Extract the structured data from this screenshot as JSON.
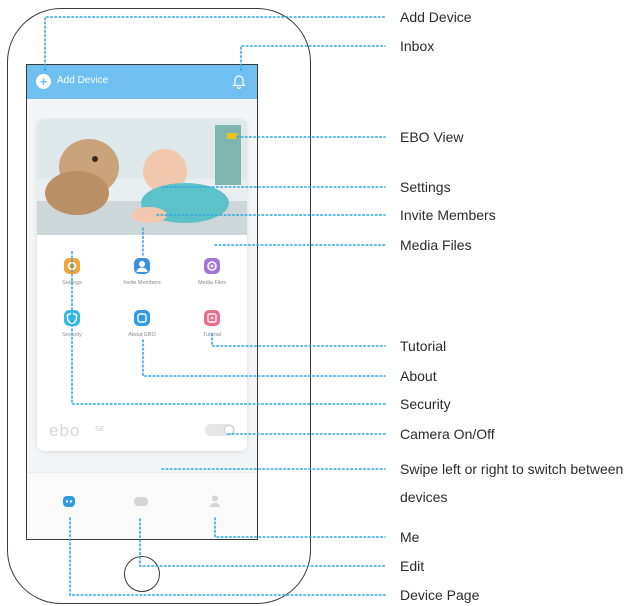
{
  "app": {
    "header_label": "Add Device",
    "accent_color": "#6fbff0"
  },
  "card": {
    "icons": [
      {
        "label": "Settings",
        "icon": "settings-icon",
        "color": "#f3a43b"
      },
      {
        "label": "Invite Members",
        "icon": "invite-members-icon",
        "color": "#3d8fe0"
      },
      {
        "label": "Media Files",
        "icon": "media-files-icon",
        "color": "#a077d8"
      },
      {
        "label": "Security",
        "icon": "security-icon",
        "color": "#35b8e8"
      },
      {
        "label": "About EBO",
        "icon": "about-icon",
        "color": "#2f9be4"
      },
      {
        "label": "Tutorial",
        "icon": "tutorial-icon",
        "color": "#ef6b8a"
      }
    ],
    "brand": "ebo",
    "brand_suffix": "SE"
  },
  "tabbar": {
    "tabs": [
      "device-page-icon",
      "edit-icon",
      "me-icon"
    ],
    "active_color": "#2f9be4",
    "inactive_color": "#d4d4d4"
  },
  "callouts": {
    "add_device": "Add Device",
    "inbox": "Inbox",
    "ebo_view": "EBO View",
    "settings": "Settings",
    "invite_members": "Invite Members",
    "media_files": "Media Files",
    "tutorial": "Tutorial",
    "about": "About",
    "security": "Security",
    "camera_toggle": "Camera On/Off",
    "swipe": "Swipe left or right to switch between devices",
    "me": "Me",
    "edit": "Edit",
    "device_page": "Device Page"
  },
  "leader_color": "#2fa6e0"
}
